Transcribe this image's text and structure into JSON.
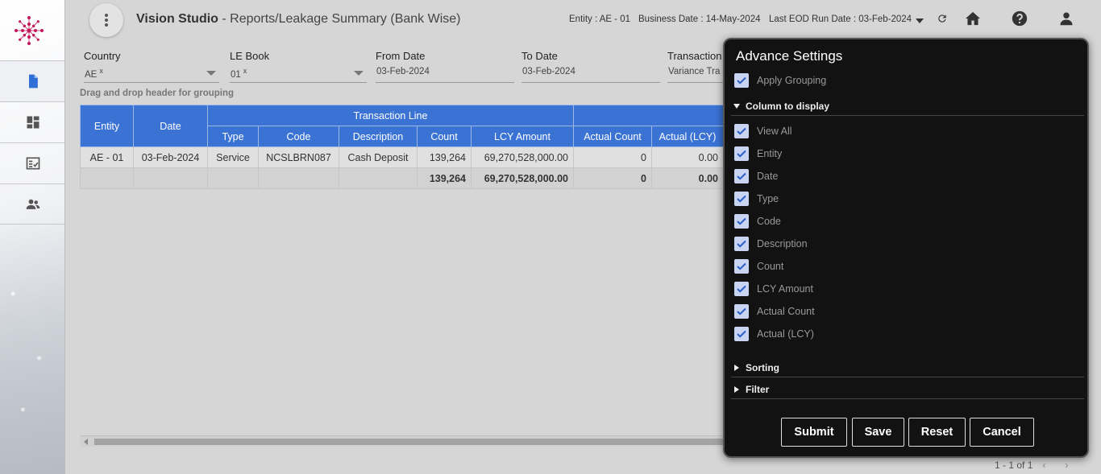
{
  "app": {
    "name": "Vision Studio",
    "page_title": " - Reports/Leakage Summary (Bank Wise)"
  },
  "header": {
    "entity_label": "Entity : ",
    "entity_value": "AE - 01",
    "business_date_label": "Business Date : ",
    "business_date_value": "14-May-2024",
    "eod_label": "Last EOD Run Date : ",
    "eod_value": "03-Feb-2024",
    "icons": [
      "refresh-icon",
      "home-icon",
      "help-icon",
      "user-icon"
    ]
  },
  "sidebar": {
    "items": [
      "report-icon",
      "dashboard-icon",
      "checklist-icon",
      "users-icon"
    ]
  },
  "filters": [
    {
      "label": "Country",
      "value": "AE",
      "clear": "x",
      "dropdown": true
    },
    {
      "label": "LE Book",
      "value": "01",
      "clear": "x",
      "dropdown": true
    },
    {
      "label": "From Date",
      "value": "03-Feb-2024",
      "clear": "",
      "dropdown": false
    },
    {
      "label": "To Date",
      "value": "03-Feb-2024",
      "clear": "",
      "dropdown": false
    },
    {
      "label": "Transaction",
      "value": "Variance Tra",
      "clear": "",
      "dropdown": false
    }
  ],
  "drag_hint": "Drag and drop header for grouping",
  "table": {
    "group_header": "Transaction Line",
    "columns": [
      "Entity",
      "Date",
      "Type",
      "Code",
      "Description",
      "Count",
      "LCY Amount",
      "Actual Count",
      "Actual (LCY)"
    ],
    "rows": [
      [
        "AE - 01",
        "03-Feb-2024",
        "Service",
        "NCSLBRN087",
        "Cash Deposit",
        "139,264",
        "69,270,528,000.00",
        "0",
        "0.00"
      ]
    ],
    "totals": [
      "",
      "",
      "",
      "",
      "",
      "139,264",
      "69,270,528,000.00",
      "0",
      "0.00"
    ]
  },
  "pager": {
    "text": "1 - 1 of 1",
    "prev": "‹",
    "next": "›"
  },
  "panel": {
    "title": "Advance Settings",
    "apply_grouping": "Apply Grouping",
    "columns_section": "Column to display",
    "column_options": [
      "View All",
      "Entity",
      "Date",
      "Type",
      "Code",
      "Description",
      "Count",
      "LCY Amount",
      "Actual Count",
      "Actual (LCY)"
    ],
    "sorting_section": "Sorting",
    "filter_section": "Filter",
    "buttons": {
      "submit": "Submit",
      "save": "Save",
      "reset": "Reset",
      "cancel": "Cancel"
    }
  }
}
